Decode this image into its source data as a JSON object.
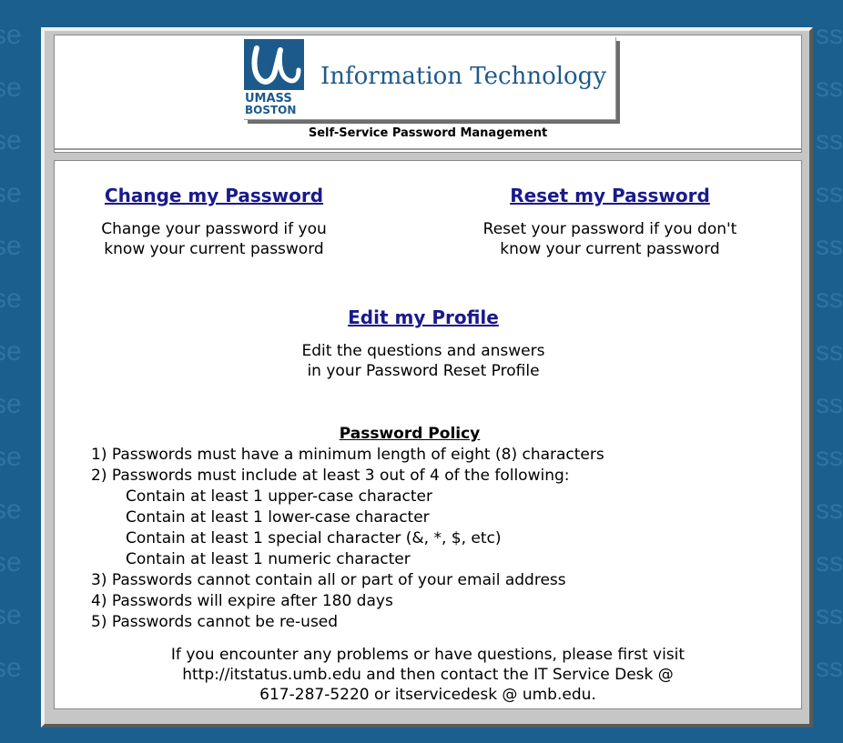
{
  "header": {
    "logo_word_1": "UMASS",
    "logo_word_2": "BOSTON",
    "logo_title": "Information Technology",
    "subtitle": "Self-Service Password Management"
  },
  "options": {
    "change": {
      "link": "Change my Password",
      "desc_line1": "Change your password if you",
      "desc_line2": "know your current password"
    },
    "reset": {
      "link": "Reset my Password",
      "desc_line1": "Reset your password if you don't",
      "desc_line2": "know your current password"
    },
    "profile": {
      "link": "Edit my Profile",
      "desc_line1": "Edit the questions and answers",
      "desc_line2": "in your Password Reset Profile"
    }
  },
  "policy": {
    "title": "Password Policy",
    "lines": [
      "1) Passwords must have a minimum length of eight (8) characters",
      "2) Passwords must include at least 3 out of 4 of the following:",
      "Contain at least 1 upper-case character",
      "Contain at least 1 lower-case character",
      "Contain at least 1 special character (&, *, $, etc)",
      "Contain at least 1 numeric character",
      "3) Passwords cannot contain all or part of your email address",
      "4) Passwords will expire after 180 days",
      "5) Passwords cannot be re-used"
    ]
  },
  "contact": {
    "line1": "If you encounter any problems or have questions, please first visit",
    "line2": "http://itstatus.umb.edu and then contact the IT Service Desk @",
    "line3": "617-287-5220 or itservicedesk @ umb.edu."
  },
  "colors": {
    "background": "#1b5f8e",
    "link": "#1a1a8c",
    "brand": "#1d5a8c"
  }
}
